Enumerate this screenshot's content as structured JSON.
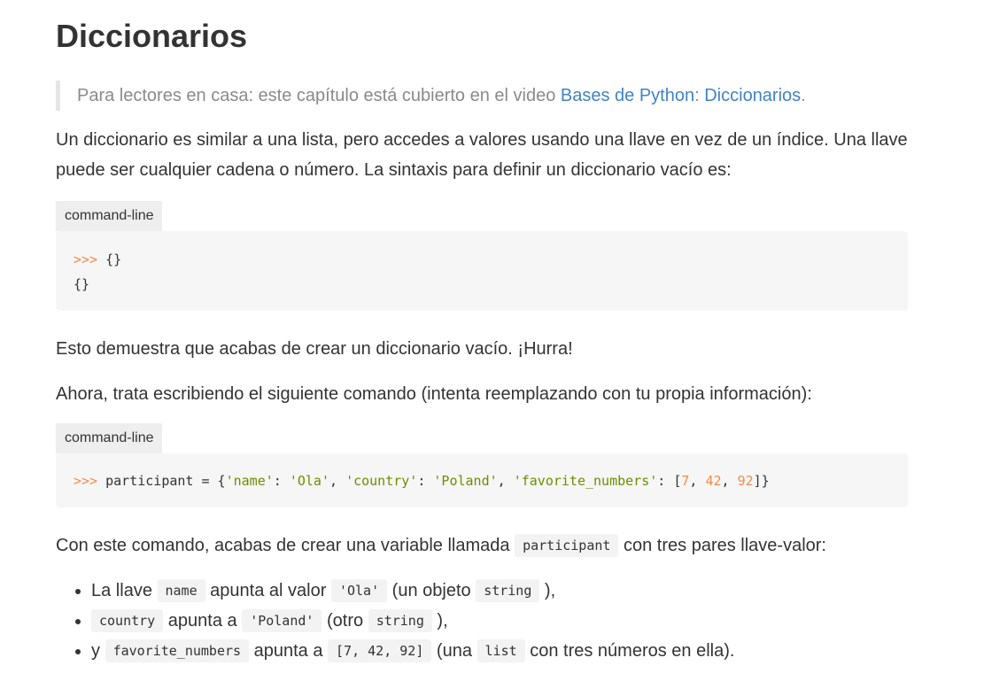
{
  "page": {
    "title": "Diccionarios",
    "note": {
      "text": "Para lectores en casa: este capítulo está cubierto en el video ",
      "link1": "Bases de Python",
      "sep": ": ",
      "link2": "Diccionarios",
      "end": "."
    },
    "intro": "Un diccionario es similar a una lista, pero accedes a valores usando una llave en vez de un índice. Una llave puede ser cualquier cadena o número. La sintaxis para definir un diccionario vacío es:",
    "code_label_1": "command-line",
    "code1": {
      "prompt": ">>>",
      "input": " {}",
      "output": "{}"
    },
    "para_hurra": "Esto demuestra que acabas de crear un diccionario vacío. ¡Hurra!",
    "para_ahora": "Ahora, trata escribiendo el siguiente comando (intenta reemplazando con tu propia información):",
    "code_label_2": "command-line",
    "code2": {
      "prompt": ">>>",
      "var": " participant = {",
      "k1": "'name'",
      "c1": ": ",
      "v1": "'Ola'",
      "s1": ", ",
      "k2": "'country'",
      "c2": ": ",
      "v2": "'Poland'",
      "s2": ", ",
      "k3": "'favorite_numbers'",
      "c3": ": [",
      "n1": "7",
      "s3": ", ",
      "n2": "42",
      "s4": ", ",
      "n3": "92",
      "end": "]}"
    },
    "para_con": {
      "before": "Con este comando, acabas de crear una variable llamada ",
      "code": "participant",
      "after": " con tres pares llave-valor:"
    },
    "bullets": [
      {
        "t1": "La llave ",
        "c1": "name",
        "t2": " apunta al valor ",
        "c2": "'Ola'",
        "t3": " (un objeto ",
        "c3": "string",
        "t4": " ),"
      },
      {
        "c1": "country",
        "t2": " apunta a ",
        "c2": "'Poland'",
        "t3": " (otro ",
        "c3": "string",
        "t4": " ),"
      },
      {
        "t1": "y ",
        "c1": "favorite_numbers",
        "t2": " apunta a ",
        "c2": "[7, 42, 92]",
        "t3": " (una ",
        "c3": "list",
        "t4": " con tres números en ella)."
      }
    ]
  }
}
